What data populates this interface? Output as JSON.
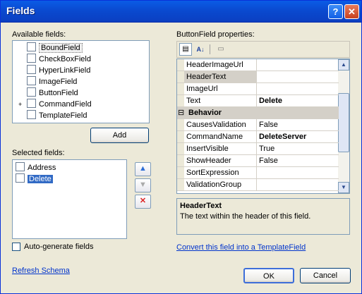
{
  "window": {
    "title": "Fields"
  },
  "labels": {
    "available_fields": "Available fields:",
    "selected_fields": "Selected fields:",
    "properties_title": "ButtonField properties:"
  },
  "available_fields": [
    {
      "label": "BoundField",
      "icon": "bound-field-icon",
      "selected": true
    },
    {
      "label": "CheckBoxField",
      "icon": "checkbox-field-icon"
    },
    {
      "label": "HyperLinkField",
      "icon": "hyperlink-field-icon"
    },
    {
      "label": "ImageField",
      "icon": "image-field-icon"
    },
    {
      "label": "ButtonField",
      "icon": "button-field-icon"
    },
    {
      "label": "CommandField",
      "icon": "command-field-icon",
      "expander": "+"
    },
    {
      "label": "TemplateField",
      "icon": "template-field-icon"
    }
  ],
  "add_button": "Add",
  "selected_fields": [
    {
      "label": "Address",
      "icon": "bound-field-icon"
    },
    {
      "label": "Delete",
      "icon": "button-field-icon",
      "selected": true
    }
  ],
  "side_buttons": {
    "up": "▲",
    "down": "▼",
    "delete": "✕"
  },
  "auto_generate": {
    "label": "Auto-generate fields",
    "checked": false
  },
  "refresh_schema": "Refresh Schema",
  "properties": [
    {
      "name": "HeaderImageUrl",
      "value": ""
    },
    {
      "name": "HeaderText",
      "value": "",
      "selected": true
    },
    {
      "name": "ImageUrl",
      "value": ""
    },
    {
      "name": "Text",
      "value": "Delete",
      "bold": true
    },
    {
      "name": "Behavior",
      "category": true
    },
    {
      "name": "CausesValidation",
      "value": "False"
    },
    {
      "name": "CommandName",
      "value": "DeleteServer",
      "bold": true
    },
    {
      "name": "InsertVisible",
      "value": "True"
    },
    {
      "name": "ShowHeader",
      "value": "False"
    },
    {
      "name": "SortExpression",
      "value": ""
    },
    {
      "name": "ValidationGroup",
      "value": ""
    }
  ],
  "category_expander": "⊟",
  "description": {
    "title": "HeaderText",
    "text": "The text within the header of this field."
  },
  "convert_link": "Convert this field into a TemplateField",
  "ok_button": "OK",
  "cancel_button": "Cancel",
  "colors": {
    "title_bar": "#0a4ad0",
    "selection": "#316ac5",
    "link": "#0033cc"
  }
}
